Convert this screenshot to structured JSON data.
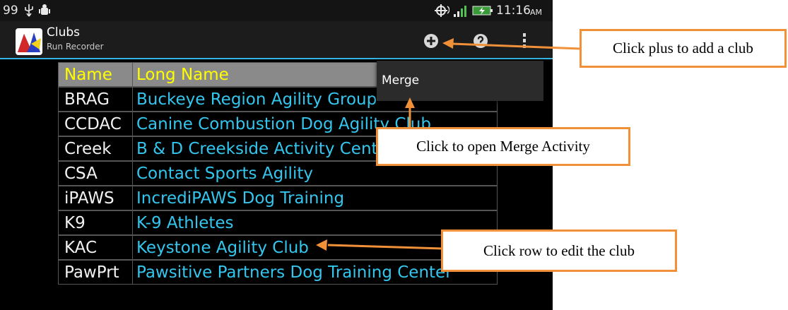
{
  "status_bar": {
    "battery_level": "99",
    "time": "11:16",
    "ampm": "AM",
    "icons": [
      "usb-icon",
      "android-debug-icon",
      "gps-icon",
      "signal-icon",
      "battery-icon"
    ]
  },
  "action_bar": {
    "title": "Clubs",
    "subtitle": "Run Recorder",
    "actions": [
      "add-icon",
      "help-icon",
      "overflow-menu-icon"
    ]
  },
  "table": {
    "headers": {
      "name": "Name",
      "long_name": "Long Name"
    },
    "rows": [
      {
        "name": "BRAG",
        "long_name": "Buckeye Region Agility Group"
      },
      {
        "name": "CCDAC",
        "long_name": "Canine Combustion Dog Agility Club"
      },
      {
        "name": "Creek",
        "long_name": "B & D Creekside Activity Center"
      },
      {
        "name": "CSA",
        "long_name": "Contact Sports Agility"
      },
      {
        "name": "iPAWS",
        "long_name": "IncrediPAWS Dog Training"
      },
      {
        "name": "K9",
        "long_name": "K-9 Athletes"
      },
      {
        "name": "KAC",
        "long_name": "Keystone Agility Club"
      },
      {
        "name": "PawPrt",
        "long_name": "Pawsitive Partners Dog Training Center"
      }
    ]
  },
  "overflow_menu": {
    "items": [
      "Merge"
    ]
  },
  "callouts": {
    "add": "Click plus to add a club",
    "merge": "Click to open Merge Activity",
    "edit": "Click row to edit the club"
  },
  "colors": {
    "accent_holo_blue": "#33b5e5",
    "long_name_text": "#33c6ee",
    "header_text": "#ffff00",
    "header_bg": "#8a8a8a",
    "callout_border": "#f0913a"
  }
}
